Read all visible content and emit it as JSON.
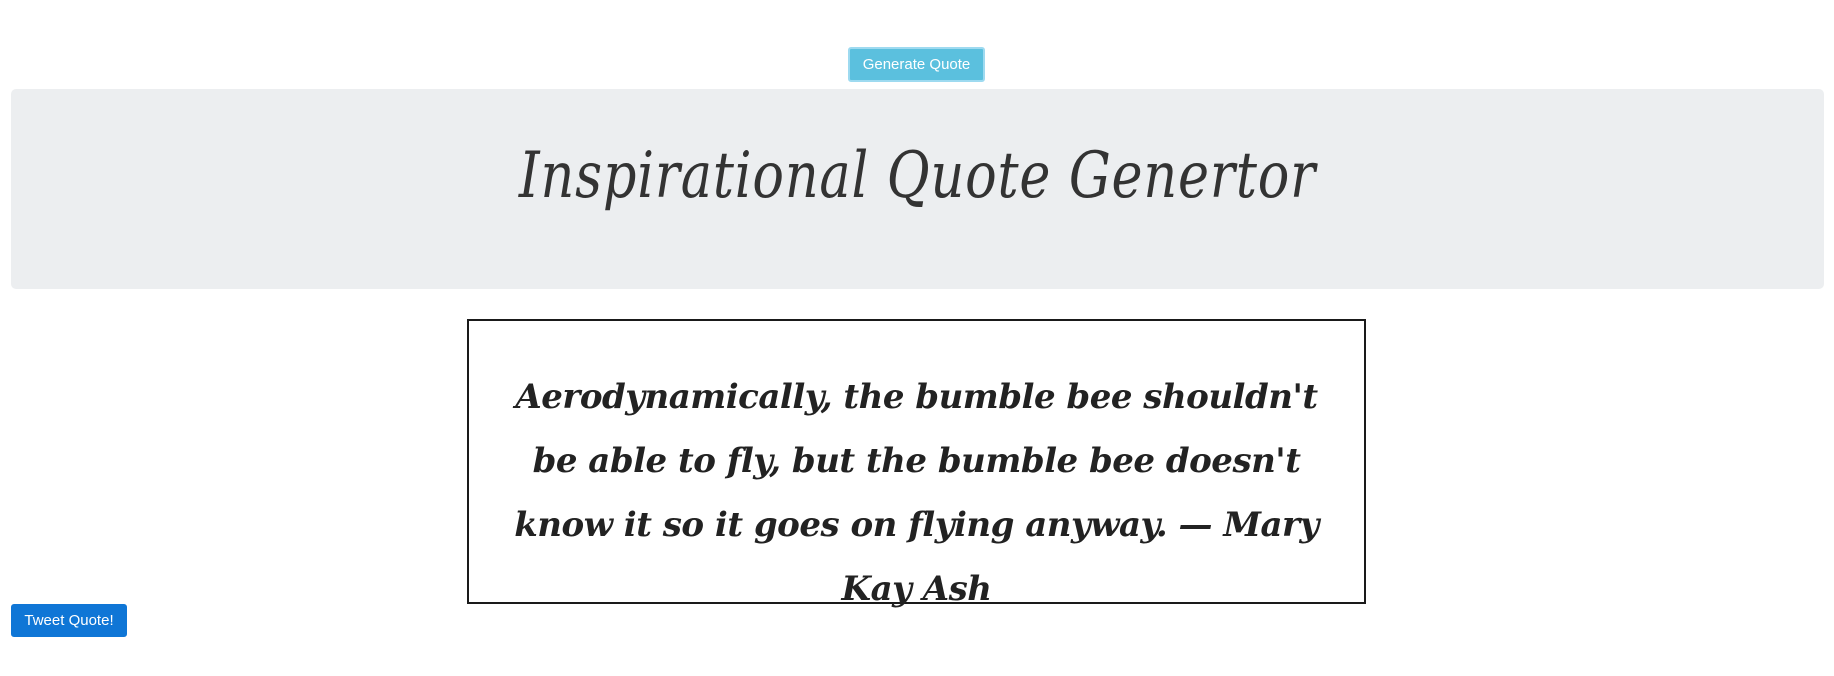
{
  "header": {
    "generate_button_label": "Generate Quote"
  },
  "jumbotron": {
    "title": "Inspirational Quote Genertor"
  },
  "quote": {
    "text": "Aerodynamically, the bumble bee shouldn't be able to fly, but the bumble bee doesn't know it so it goes on flying anyway. — Mary Kay Ash"
  },
  "footer": {
    "tweet_button_label": "Tweet Quote!"
  },
  "colors": {
    "generate_button": "#5bc0de",
    "tweet_button": "#0f76d6",
    "jumbotron_bg": "#eceef0"
  }
}
